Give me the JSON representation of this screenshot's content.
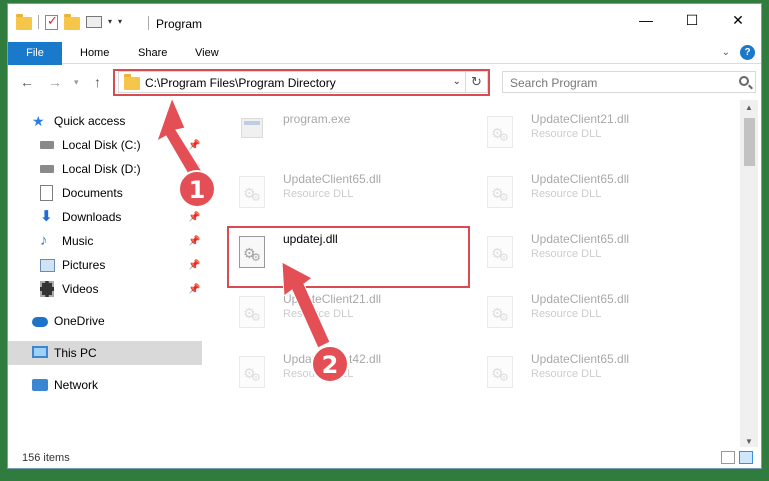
{
  "window": {
    "title": "Program"
  },
  "window_controls": {
    "minimize": "—",
    "maximize": "☐",
    "close": "✕"
  },
  "ribbon": {
    "tabs": [
      "File",
      "Home",
      "Share",
      "View"
    ],
    "help": "?"
  },
  "address": {
    "path": "C:\\Program Files\\Program Directory"
  },
  "search": {
    "placeholder": "Search Program"
  },
  "sidebar": {
    "items": [
      {
        "label": "Quick access",
        "icon": "star-icon",
        "pinned": false
      },
      {
        "label": "Local Disk (C:)",
        "icon": "disk-icon",
        "pinned": true
      },
      {
        "label": "Local Disk (D:)",
        "icon": "disk-icon",
        "pinned": true
      },
      {
        "label": "Documents",
        "icon": "documents-icon",
        "pinned": true
      },
      {
        "label": "Downloads",
        "icon": "downloads-icon",
        "pinned": true
      },
      {
        "label": "Music",
        "icon": "music-icon",
        "pinned": true
      },
      {
        "label": "Pictures",
        "icon": "pictures-icon",
        "pinned": true
      },
      {
        "label": "Videos",
        "icon": "videos-icon",
        "pinned": true
      },
      {
        "label": "OneDrive",
        "icon": "onedrive-icon",
        "pinned": false
      },
      {
        "label": "This PC",
        "icon": "this-pc-icon",
        "pinned": false,
        "selected": true
      },
      {
        "label": "Network",
        "icon": "network-icon",
        "pinned": false
      }
    ]
  },
  "files": [
    {
      "name": "program.exe",
      "type": "",
      "icon": "exe-icon",
      "faded": true
    },
    {
      "name": "UpdateClient21.dll",
      "type": "Resource DLL",
      "icon": "dll-icon",
      "faded": true
    },
    {
      "name": "UpdateClient65.dll",
      "type": "Resource DLL",
      "icon": "dll-icon",
      "faded": true
    },
    {
      "name": "UpdateClient65.dll",
      "type": "Resource DLL",
      "icon": "dll-icon",
      "faded": true
    },
    {
      "name": "updatej.dll",
      "type": "",
      "icon": "dll-icon",
      "faded": false
    },
    {
      "name": "UpdateClient65.dll",
      "type": "Resource DLL",
      "icon": "dll-icon",
      "faded": true
    },
    {
      "name": "UpdateClient21.dll",
      "type": "Resource DLL",
      "icon": "dll-icon",
      "faded": true
    },
    {
      "name": "UpdateClient65.dll",
      "type": "Resource DLL",
      "icon": "dll-icon",
      "faded": true
    },
    {
      "name": "UpdateClient42.dll",
      "type": "Resource DLL",
      "icon": "dll-icon",
      "faded": true
    },
    {
      "name": "UpdateClient65.dll",
      "type": "Resource DLL",
      "icon": "dll-icon",
      "faded": true
    }
  ],
  "status": {
    "items": "156 items"
  },
  "annotations": {
    "step1": "1",
    "step2": "2",
    "color": "#e34f55"
  }
}
